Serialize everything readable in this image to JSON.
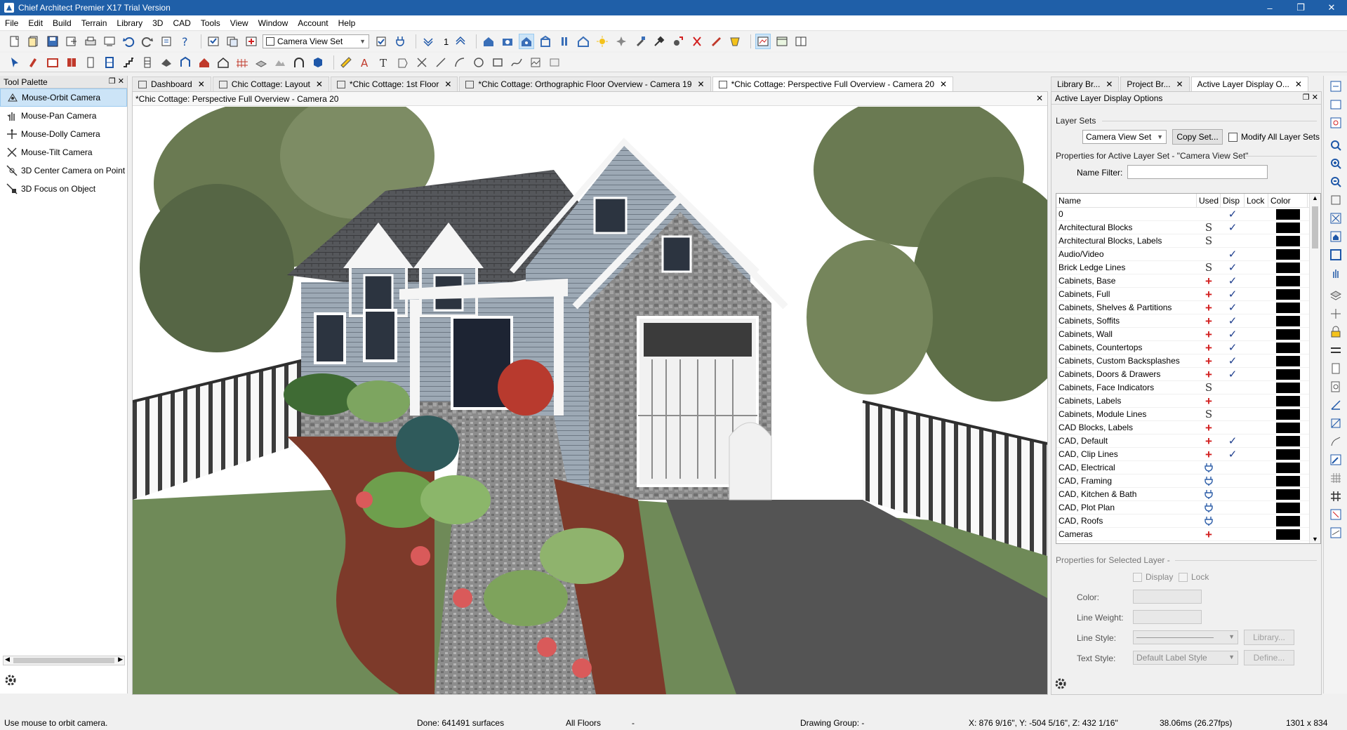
{
  "window": {
    "title": "Chief Architect Premier X17 Trial Version"
  },
  "menu": [
    "File",
    "Edit",
    "Build",
    "Terrain",
    "Library",
    "3D",
    "CAD",
    "Tools",
    "View",
    "Window",
    "Account",
    "Help"
  ],
  "toolbar": {
    "layer_set_combo": "Camera View Set",
    "counter": "1"
  },
  "tool_palette": {
    "title": "Tool Palette",
    "items": [
      {
        "label": "Mouse-Orbit Camera",
        "icon": "orbit-camera-icon"
      },
      {
        "label": "Mouse-Pan Camera",
        "icon": "pan-hand-icon"
      },
      {
        "label": "Mouse-Dolly Camera",
        "icon": "dolly-camera-icon"
      },
      {
        "label": "Mouse-Tilt Camera",
        "icon": "tilt-camera-icon"
      },
      {
        "label": "3D Center Camera on Point",
        "icon": "center-camera-icon"
      },
      {
        "label": "3D Focus on Object",
        "icon": "focus-object-icon"
      }
    ]
  },
  "doc_tabs": [
    {
      "label": "Dashboard"
    },
    {
      "label": "Chic Cottage: Layout"
    },
    {
      "label": "*Chic Cottage: 1st Floor"
    },
    {
      "label": "*Chic Cottage: Orthographic Floor Overview - Camera 19"
    },
    {
      "label": "*Chic Cottage: Perspective Full Overview - Camera 20"
    }
  ],
  "view": {
    "title": "*Chic Cottage: Perspective Full Overview - Camera 20"
  },
  "right_tabs": [
    {
      "label": "Library Br..."
    },
    {
      "label": "Project Br..."
    },
    {
      "label": "Active Layer Display O..."
    }
  ],
  "layer_panel": {
    "title": "Active Layer Display Options",
    "layer_sets_label": "Layer Sets",
    "layer_set_value": "Camera View Set",
    "copy_set_label": "Copy Set...",
    "modify_all_label": "Modify All Layer Sets",
    "properties_label": "Properties for Active Layer Set - \"Camera View Set\"",
    "name_filter_label": "Name Filter:",
    "name_filter_value": "",
    "columns": {
      "name": "Name",
      "used": "Used",
      "disp": "Disp",
      "lock": "Lock",
      "color": "Color"
    },
    "rows": [
      {
        "name": "0",
        "used": "",
        "disp": "✓"
      },
      {
        "name": "Architectural Blocks",
        "used": "S",
        "disp": "✓"
      },
      {
        "name": "Architectural Blocks, Labels",
        "used": "S",
        "disp": ""
      },
      {
        "name": "Audio/Video",
        "used": "",
        "disp": "✓"
      },
      {
        "name": "Brick Ledge Lines",
        "used": "S",
        "disp": "✓"
      },
      {
        "name": "Cabinets,  Base",
        "used": "+",
        "disp": "✓"
      },
      {
        "name": "Cabinets,  Full",
        "used": "+",
        "disp": "✓"
      },
      {
        "name": "Cabinets,  Shelves & Partitions",
        "used": "+",
        "disp": "✓"
      },
      {
        "name": "Cabinets,  Soffits",
        "used": "+",
        "disp": "✓"
      },
      {
        "name": "Cabinets,  Wall",
        "used": "+",
        "disp": "✓"
      },
      {
        "name": "Cabinets, Countertops",
        "used": "+",
        "disp": "✓"
      },
      {
        "name": "Cabinets, Custom Backsplashes",
        "used": "+",
        "disp": "✓"
      },
      {
        "name": "Cabinets, Doors & Drawers",
        "used": "+",
        "disp": "✓"
      },
      {
        "name": "Cabinets, Face Indicators",
        "used": "S",
        "disp": ""
      },
      {
        "name": "Cabinets, Labels",
        "used": "+",
        "disp": ""
      },
      {
        "name": "Cabinets, Module Lines",
        "used": "S",
        "disp": ""
      },
      {
        "name": "CAD Blocks, Labels",
        "used": "+",
        "disp": ""
      },
      {
        "name": "CAD,  Default",
        "used": "+",
        "disp": "✓"
      },
      {
        "name": "CAD, Clip Lines",
        "used": "+",
        "disp": "✓"
      },
      {
        "name": "CAD, Electrical",
        "used": "plug",
        "disp": ""
      },
      {
        "name": "CAD, Framing",
        "used": "plug",
        "disp": ""
      },
      {
        "name": "CAD, Kitchen & Bath",
        "used": "plug",
        "disp": ""
      },
      {
        "name": "CAD, Plot Plan",
        "used": "plug",
        "disp": ""
      },
      {
        "name": "CAD, Roofs",
        "used": "plug",
        "disp": ""
      },
      {
        "name": "Cameras",
        "used": "+",
        "disp": ""
      }
    ],
    "selected_props_label": "Properties for Selected Layer -",
    "display_label": "Display",
    "lock_label": "Lock",
    "color_label": "Color:",
    "line_weight_label": "Line Weight:",
    "line_style_label": "Line Style:",
    "text_style_label": "Text Style:",
    "text_style_value": "Default Label Style",
    "library_btn": "Library...",
    "define_btn": "Define..."
  },
  "status": {
    "hint": "Use mouse to orbit camera.",
    "done": "Done:  641491 surfaces",
    "floors": "All Floors",
    "dash": "-",
    "drawing_group": "Drawing Group: -",
    "coords": "X: 876 9/16\", Y: -504 5/16\", Z: 432 1/16\"",
    "fps": "38.06ms (26.27fps)",
    "size": "1301 x 834"
  },
  "colors": {
    "titlebar": "#1f5fa8",
    "active_tab": "#ffffff",
    "plus_red": "#d21f1f",
    "check_blue": "#1c3c8c"
  }
}
